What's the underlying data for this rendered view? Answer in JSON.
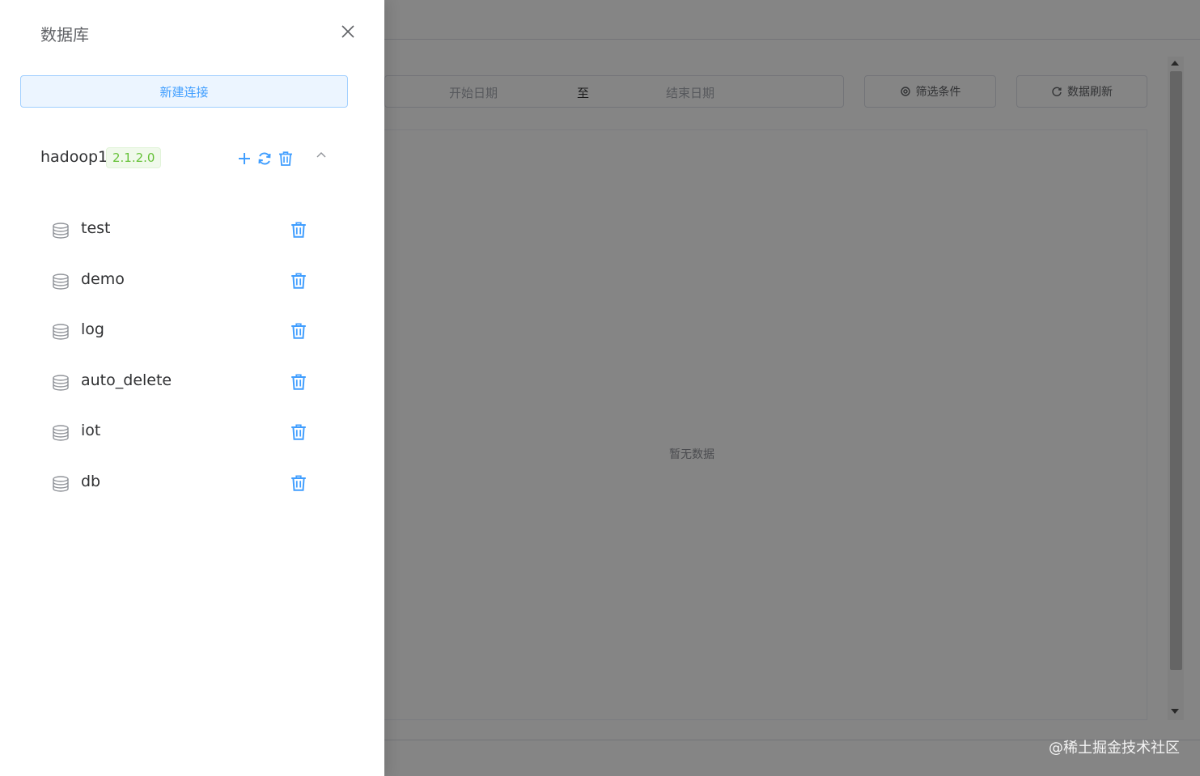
{
  "background": {
    "date_start_placeholder": "开始日期",
    "date_separator": "至",
    "date_end_placeholder": "结束日期",
    "filter_label": "筛选条件",
    "refresh_label": "数据刷新",
    "empty_text": "暂无数据",
    "watermark": "@稀土掘金技术社区"
  },
  "drawer": {
    "title": "数据库",
    "new_connection_label": "新建连接",
    "connection": {
      "name": "hadoop1",
      "version": "2.1.2.0"
    },
    "databases": [
      {
        "name": "test"
      },
      {
        "name": "demo"
      },
      {
        "name": "log"
      },
      {
        "name": "auto_delete"
      },
      {
        "name": "iot"
      },
      {
        "name": "db"
      }
    ]
  },
  "colors": {
    "primary": "#409eff",
    "success": "#67c23a",
    "overlay": "rgba(0,0,0,0.48)"
  },
  "icons": {
    "close": "close-icon",
    "add": "plus-icon",
    "refresh": "refresh-icon",
    "delete": "trash-icon",
    "collapse": "chevron-up-icon",
    "database": "database-icon",
    "filter": "gear-icon"
  }
}
